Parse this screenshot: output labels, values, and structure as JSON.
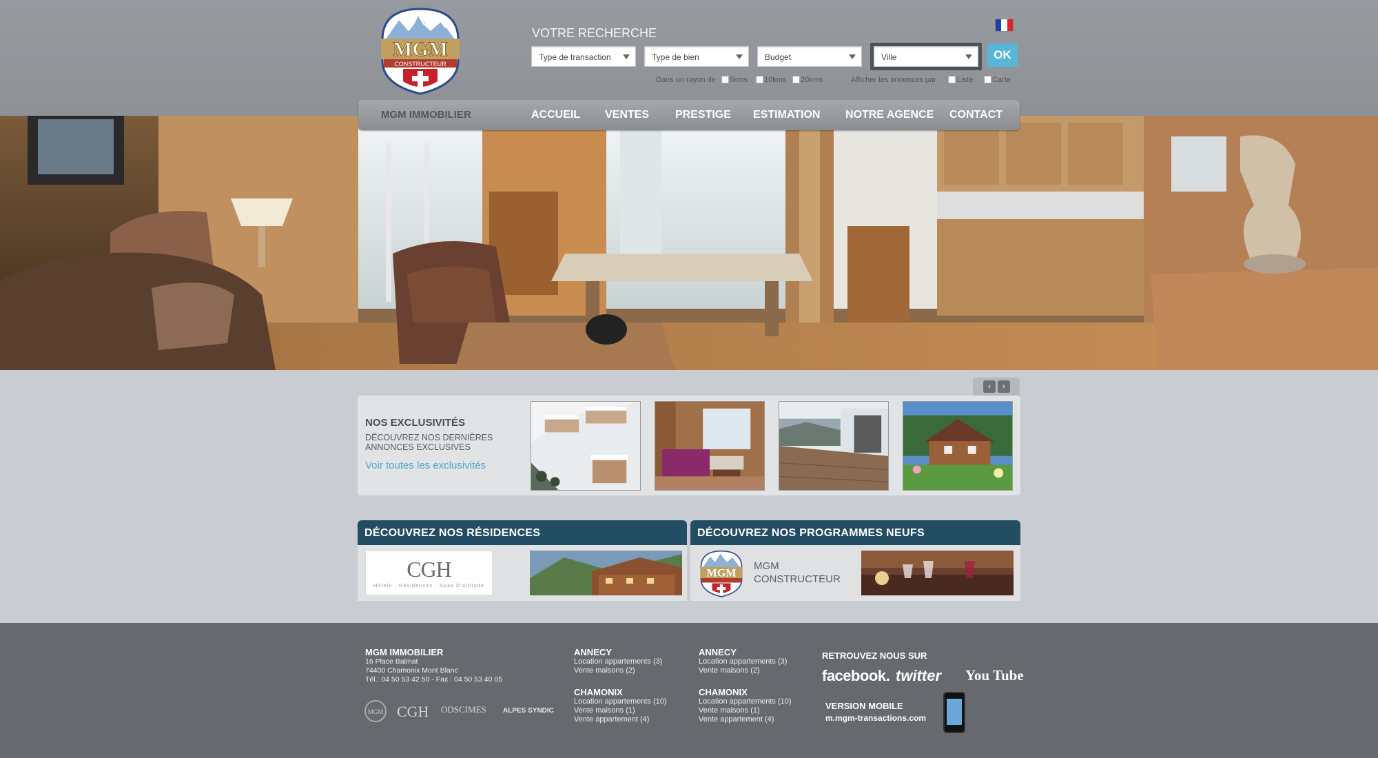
{
  "header": {
    "logo_text": "MGM",
    "logo_sub": "CONSTRUCTEUR",
    "search_title": "VOTRE RECHERCHE",
    "selects": [
      {
        "label": "Type de transaction"
      },
      {
        "label": "Type de bien"
      },
      {
        "label": "Budget"
      },
      {
        "label": "Ville"
      }
    ],
    "ok_label": "OK",
    "radius_label": "Dans un rayon de",
    "radius_options": [
      "5kms",
      "10kms",
      "20kms"
    ],
    "display_label": "Afficher les annonces par",
    "display_options": [
      "Liste",
      "Carte"
    ],
    "language": "flag-fr"
  },
  "nav": {
    "brand": "MGM IMMOBILIER",
    "items": [
      "ACCUEIL",
      "VENTES",
      "PRESTIGE",
      "ESTIMATION",
      "NOTRE AGENCE",
      "CONTACT"
    ]
  },
  "exclusives": {
    "title": "NOS EXCLUSIVITÉS",
    "subtitle_1": "DÉCOUVREZ NOS DERNIÈRES",
    "subtitle_2": "ANNONCES EXCLUSIVES",
    "link": "Voir toutes les exclusivités",
    "prev": "‹",
    "next": "›"
  },
  "residences": {
    "title": "DÉCOUVREZ NOS RÉSIDENCES",
    "cgh_logo": "CGH",
    "cgh_sub": "Hôtels · Résidences · Spas D'altitude"
  },
  "programmes": {
    "title": "DÉCOUVREZ NOS PROGRAMMES NEUFS",
    "line1": "MGM",
    "line2": "CONSTRUCTEUR"
  },
  "footer": {
    "company": "MGM IMMOBILIER",
    "address1": "16 Place Balmat",
    "address2": "74400 Chamonix Mont Blanc",
    "phone": "Tél.: 04 50 53 42 50 - Fax : 04 50 53 40 05",
    "partner_logos": [
      "CGH",
      "ODSCIMES",
      "ALPES SYNDIC"
    ],
    "col1": {
      "city1": "ANNECY",
      "city1_links": [
        "Location appartements (3)",
        "Vente maisons (2)"
      ],
      "city2": "CHAMONIX",
      "city2_links": [
        "Location appartements (10)",
        "Vente maisons (1)",
        "Vente appartement (4)"
      ]
    },
    "col2": {
      "city1": "ANNECY",
      "city1_links": [
        "Location appartements (3)",
        "Vente maisons (2)"
      ],
      "city2": "CHAMONIX",
      "city2_links": [
        "Location appartements (10)",
        "Vente maisons (1)",
        "Vente appartement (4)"
      ]
    },
    "social_title": "RETROUVEZ NOUS SUR",
    "social": [
      "facebook.",
      "twitter",
      "You Tube"
    ],
    "mobile_title": "VERSION MOBILE",
    "mobile_url": "m.mgm-transactions.com"
  },
  "colors": {
    "header_bg": "#979a9e",
    "section_head": "#234d62",
    "ok_button": "#57b6da",
    "link": "#4fa6cf",
    "footer_bg": "#666a6e"
  }
}
